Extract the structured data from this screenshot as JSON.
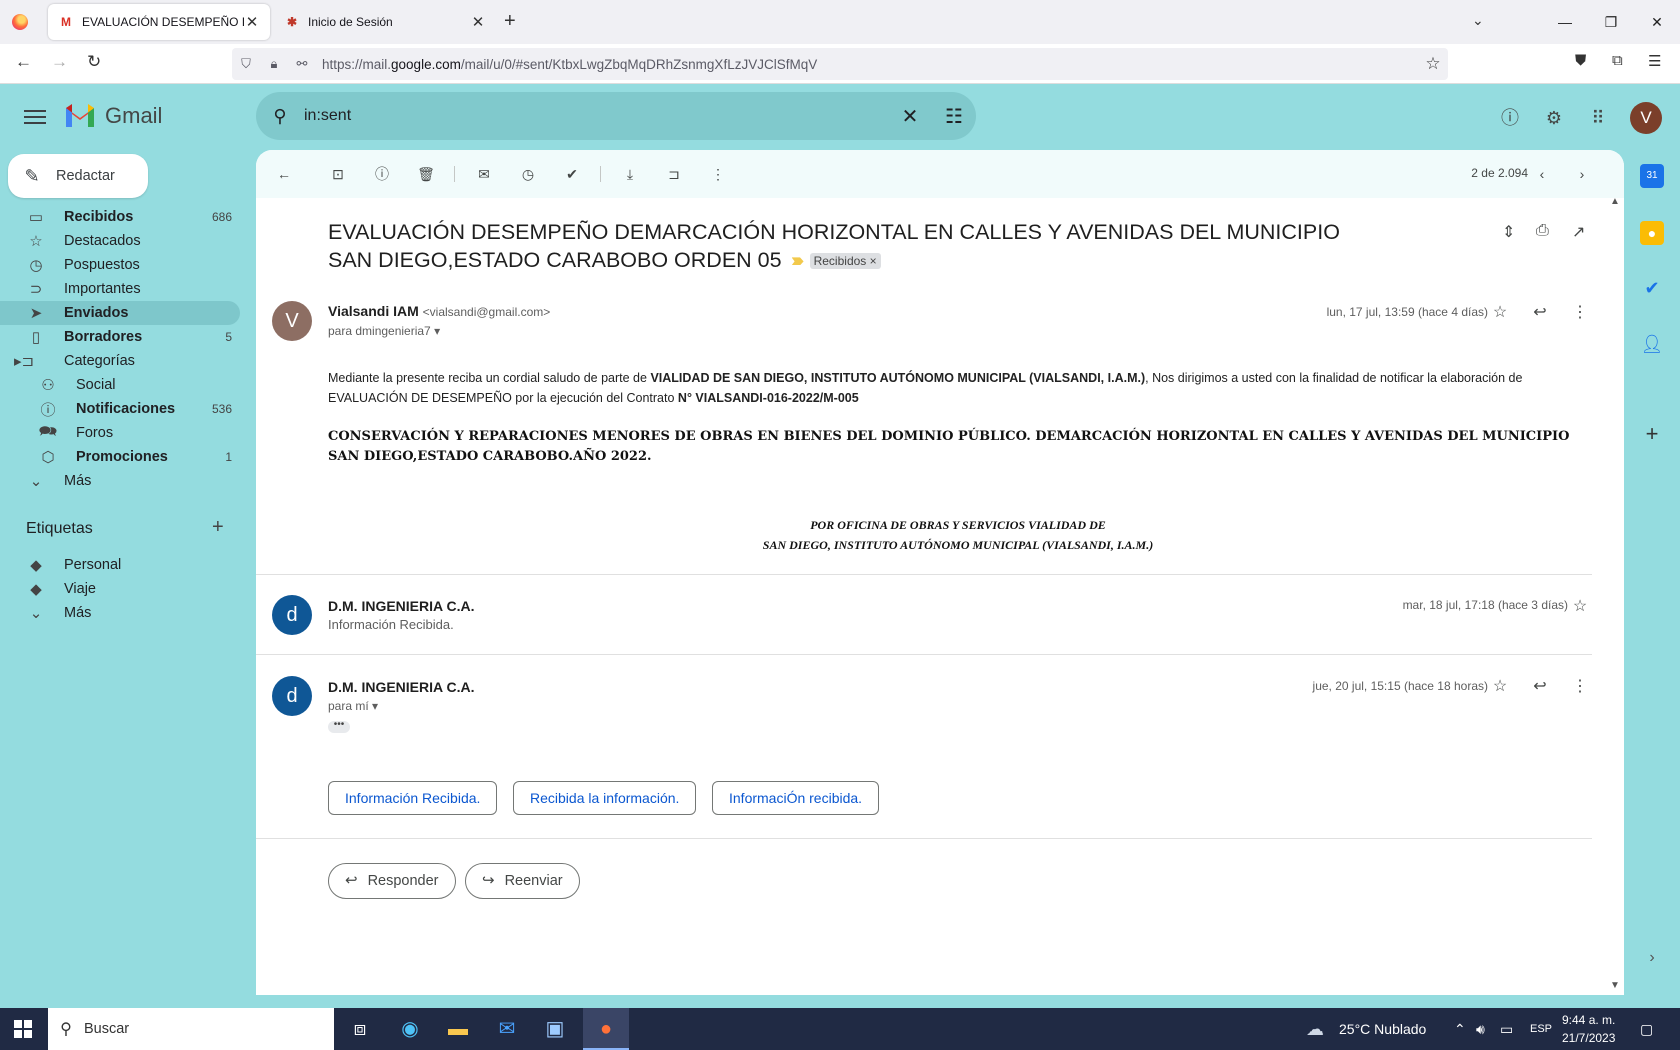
{
  "browser": {
    "tabs": [
      {
        "title": "EVALUACIÓN DESEMPEÑO DEMARCACIÓN",
        "favicon": "M"
      },
      {
        "title": "Inicio de Sesión",
        "favicon": "✱"
      }
    ],
    "url_prefix": "https://mail.",
    "url_domain": "google.com",
    "url_path": "/mail/u/0/#sent/KtbxLwgZbqMqDRhZsnmgXfLzJVJClSfMqV"
  },
  "gmail": {
    "logo_text": "Gmail",
    "search_value": "in:sent",
    "avatar_initial": "V",
    "compose_label": "Redactar"
  },
  "nav": [
    {
      "label": "Recibidos",
      "count": "686",
      "icon": "inbox-icon",
      "bold": true
    },
    {
      "label": "Destacados",
      "count": "",
      "icon": "star-icon"
    },
    {
      "label": "Pospuestos",
      "count": "",
      "icon": "clock-icon"
    },
    {
      "label": "Importantes",
      "count": "",
      "icon": "important-icon"
    },
    {
      "label": "Enviados",
      "count": "",
      "icon": "send-icon",
      "bold": true,
      "active": true
    },
    {
      "label": "Borradores",
      "count": "5",
      "icon": "draft-icon",
      "bold": true
    },
    {
      "label": "Categorías",
      "count": "",
      "icon": "label-icon"
    },
    {
      "label": "Social",
      "count": "",
      "icon": "people-icon"
    },
    {
      "label": "Notificaciones",
      "count": "536",
      "icon": "info-icon",
      "bold": true
    },
    {
      "label": "Foros",
      "count": "",
      "icon": "forum-icon"
    },
    {
      "label": "Promociones",
      "count": "1",
      "icon": "tag-icon",
      "bold": true
    },
    {
      "label": "Más",
      "count": "",
      "icon": "chevron-down-icon"
    }
  ],
  "labels": {
    "header": "Etiquetas",
    "items": [
      {
        "label": "Personal"
      },
      {
        "label": "Viaje"
      },
      {
        "label": "Más"
      }
    ]
  },
  "toolbar": {
    "pager": "2 de 2.094"
  },
  "thread": {
    "subject": "EVALUACIÓN DESEMPEÑO DEMARCACIÓN HORIZONTAL EN CALLES Y AVENIDAS DEL MUNICIPIO SAN DIEGO,ESTADO CARABOBO ORDEN 05",
    "label_chip": "Recibidos",
    "messages": [
      {
        "sender": "Vialsandi IAM",
        "email": "<vialsandi@gmail.com>",
        "to": "para dmingenieria7",
        "date": "lun, 17 jul, 13:59 (hace 4 días)",
        "avatar": "V",
        "body_1": "Mediante la presente reciba un cordial saludo de parte de ",
        "body_org": "VIALIDAD DE SAN DIEGO, INSTITUTO AUTÓNOMO MUNICIPAL (VIALSANDI, I.A.M.)",
        "body_2": ", Nos dirigimos a usted con la finalidad de notificar la elaboración de EVALUACIÓN DE DESEMPEÑO por la ejecución del Contrato  ",
        "body_contract": "N° VIALSANDI-016-2022/M-005",
        "heading": "CONSERVACIÓN Y REPARACIONES MENORES DE OBRAS EN BIENES DEL DOMINIO PÚBLICO. DEMARCACIÓN HORIZONTAL EN CALLES Y AVENIDAS DEL MUNICIPIO SAN DIEGO,ESTADO CARABOBO.AÑO 2022.",
        "signature_1": "POR  OFICINA DE OBRAS Y SERVICIOS VIALIDAD DE",
        "signature_2": "SAN DIEGO, INSTITUTO AUTÓNOMO MUNICIPAL (VIALSANDI, I.A.M.)"
      },
      {
        "sender": "D.M. INGENIERIA C.A.",
        "snippet": "Información Recibida.",
        "date": "mar, 18 jul, 17:18 (hace 3 días)",
        "avatar": "d"
      },
      {
        "sender": "D.M. INGENIERIA C.A.",
        "to": "para mí",
        "date": "jue, 20 jul, 15:15 (hace 18 horas)",
        "avatar": "d",
        "ellipsis": "•••"
      }
    ],
    "smart_replies": [
      "Información Recibida.",
      "Recibida la información.",
      "InformaciÓn recibida."
    ],
    "reply_label": "Responder",
    "forward_label": "Reenviar"
  },
  "taskbar": {
    "search_placeholder": "Buscar",
    "weather": "25°C  Nublado",
    "lang": "ESP",
    "time": "9:44 a. m.",
    "date": "21/7/2023"
  },
  "colors": {
    "theme_bg": "#94dcdf",
    "search_bg": "#80c9cc",
    "active_nav": "#7ec7cb",
    "link_blue": "#0b57d0"
  }
}
